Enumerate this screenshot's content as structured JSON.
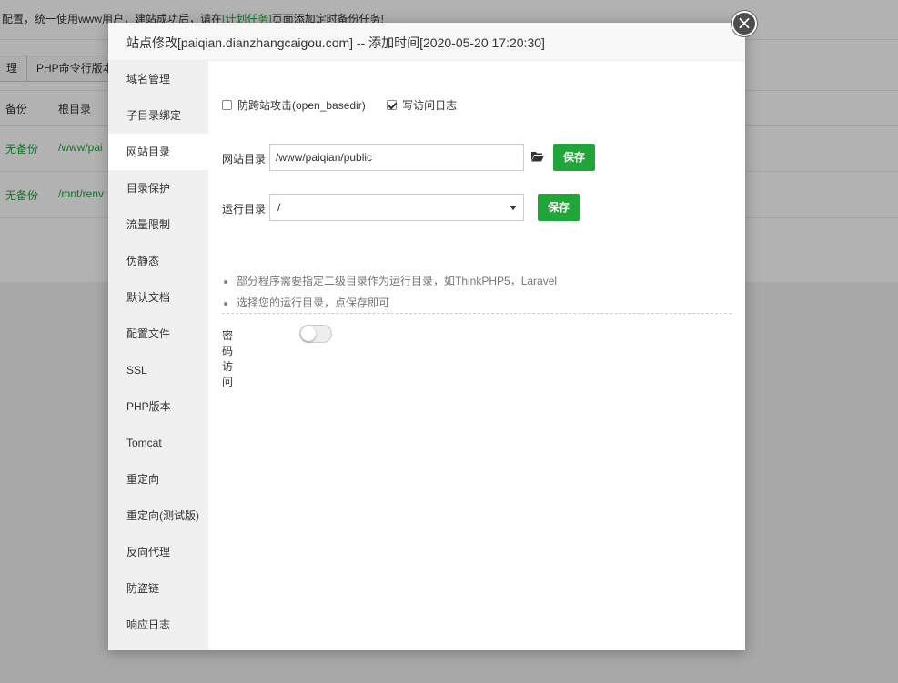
{
  "background": {
    "notice_text": "配置，统一使用www用户，建站成功后，请在",
    "notice_link": "[计划任务]",
    "notice_text_after": "页面添加定时备份任务!",
    "toolbar": {
      "btn1": "理",
      "btn2": "PHP命令行版本"
    },
    "table": {
      "headers": [
        "备份",
        "根目录"
      ],
      "rows": [
        {
          "backup": "无备份",
          "root": "/www/pai"
        },
        {
          "backup": "无备份",
          "root": "/mnt/renv"
        }
      ]
    }
  },
  "modal": {
    "title": "站点修改[paiqian.dianzhangcaigou.com] -- 添加时间[2020-05-20 17:20:30]",
    "close_label": "×",
    "sidebar": {
      "items": [
        {
          "label": "域名管理"
        },
        {
          "label": "子目录绑定"
        },
        {
          "label": "网站目录"
        },
        {
          "label": "目录保护"
        },
        {
          "label": "流量限制"
        },
        {
          "label": "伪静态"
        },
        {
          "label": "默认文档"
        },
        {
          "label": "配置文件"
        },
        {
          "label": "SSL"
        },
        {
          "label": "PHP版本"
        },
        {
          "label": "Tomcat"
        },
        {
          "label": "重定向"
        },
        {
          "label": "重定向(测试版)"
        },
        {
          "label": "反向代理"
        },
        {
          "label": "防盗链"
        },
        {
          "label": "响应日志"
        }
      ],
      "active_index": 2
    },
    "content": {
      "checkbox_basedir": {
        "label": "防跨站攻击(open_basedir)",
        "checked": false
      },
      "checkbox_log": {
        "label": "写访问日志",
        "checked": true
      },
      "site_dir": {
        "label": "网站目录",
        "value": "/www/paiqian/public",
        "save_label": "保存"
      },
      "run_dir": {
        "label": "运行目录",
        "selected": "/",
        "save_label": "保存"
      },
      "tips": [
        "部分程序需要指定二级目录作为运行目录，如ThinkPHP5，Laravel",
        "选择您的运行目录，点保存即可"
      ],
      "password_access": {
        "label": "密码访问",
        "enabled": false
      }
    },
    "colors": {
      "accent": "#20a53a"
    }
  }
}
